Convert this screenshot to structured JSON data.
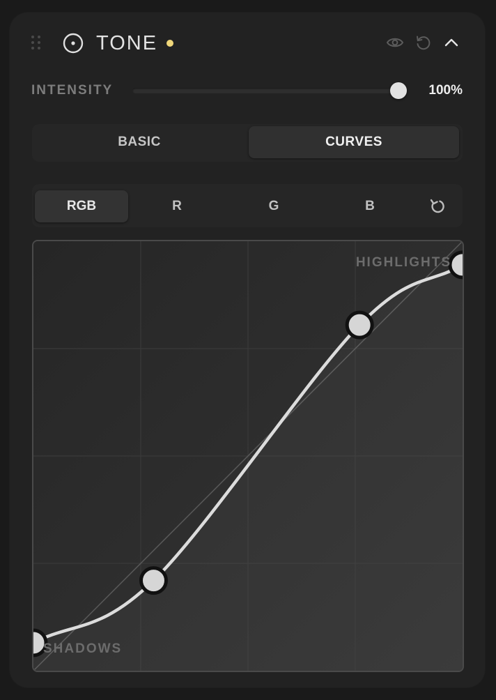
{
  "header": {
    "title": "TONE",
    "status_color": "#f0d77a",
    "icons": {
      "drag": "drag-handle-icon",
      "tone": "tone-circle-icon",
      "visibility": "eye-icon",
      "reset": "reset-icon",
      "collapse": "chevron-up-icon"
    }
  },
  "intensity": {
    "label": "INTENSITY",
    "value_text": "100%",
    "value": 100
  },
  "mode_toggle": {
    "options": [
      "BASIC",
      "CURVES"
    ],
    "selected": "CURVES"
  },
  "channels": {
    "options": [
      "RGB",
      "R",
      "G",
      "B"
    ],
    "selected": "RGB",
    "reset_icon": "reset-curve-icon"
  },
  "curve": {
    "shadows_label": "SHADOWS",
    "highlights_label": "HIGHLIGHTS",
    "points": [
      {
        "x": 0.0,
        "y": 0.065
      },
      {
        "x": 0.28,
        "y": 0.21
      },
      {
        "x": 0.76,
        "y": 0.805
      },
      {
        "x": 1.0,
        "y": 0.945
      }
    ],
    "grid_divisions": 4,
    "curve_color": "#dcdcdc"
  }
}
